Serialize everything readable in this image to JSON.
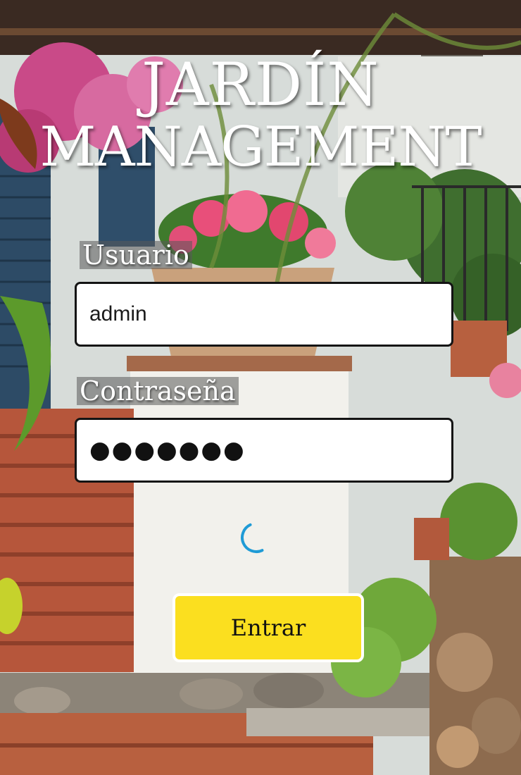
{
  "app": {
    "title_line1": "JARDÍN",
    "title_line2": "MANAGEMENT"
  },
  "form": {
    "username_label": "Usuario",
    "username_value": "admin",
    "password_label": "Contraseña",
    "password_mask": "●●●●●●●",
    "submit_label": "Entrar",
    "loading": true
  },
  "colors": {
    "button_bg": "#fbdf1f",
    "spinner": "#1f9bd6"
  },
  "icons": {
    "spinner": "loading-spinner-icon"
  }
}
